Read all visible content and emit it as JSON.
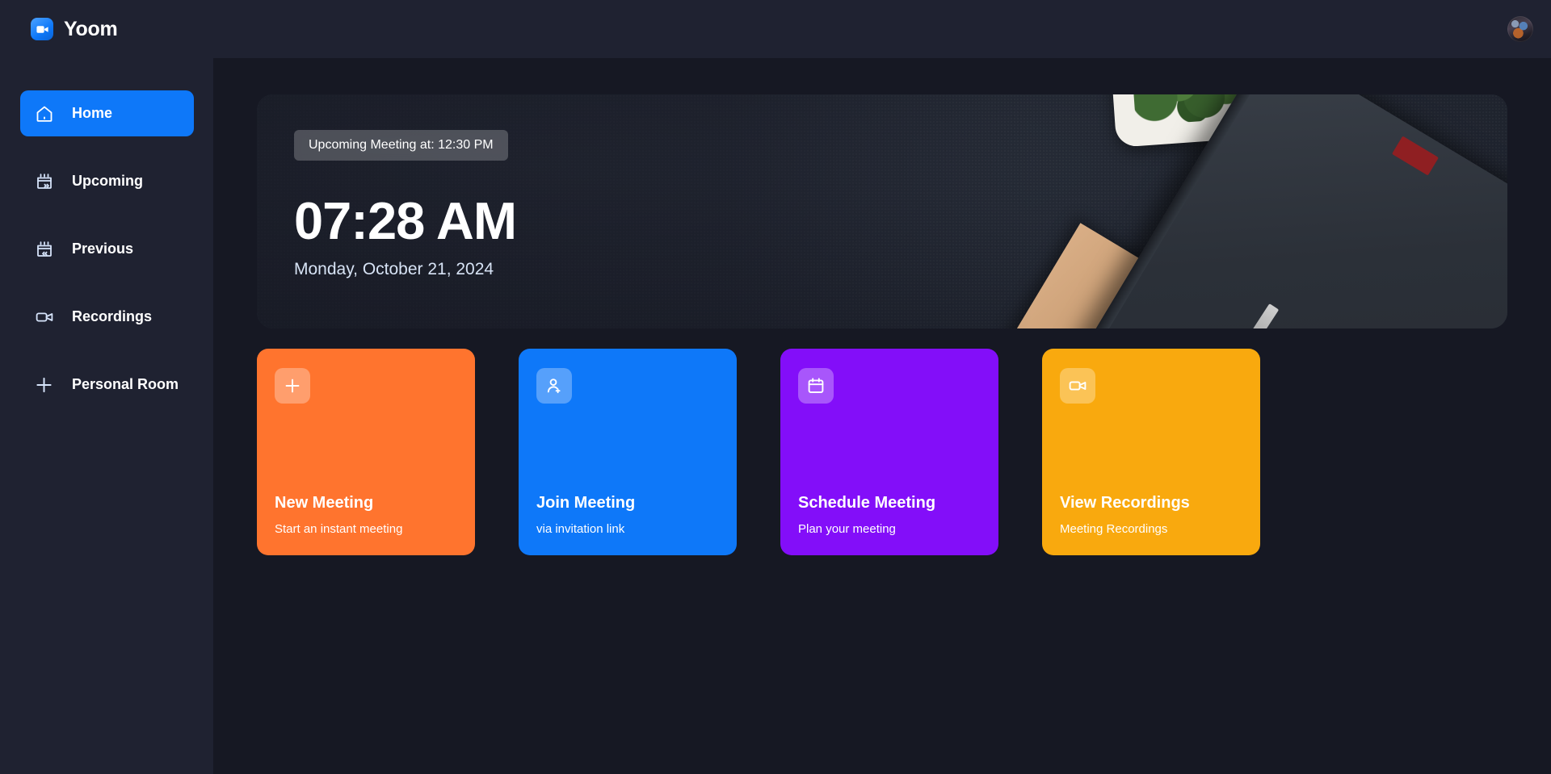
{
  "header": {
    "brand_name": "Yoom",
    "brand_icon": "video-camera-icon",
    "avatar_icon": "user-avatar"
  },
  "sidebar": {
    "items": [
      {
        "label": "Home",
        "icon": "home-icon",
        "active": true
      },
      {
        "label": "Upcoming",
        "icon": "calendar-forward-icon",
        "active": false
      },
      {
        "label": "Previous",
        "icon": "calendar-back-icon",
        "active": false
      },
      {
        "label": "Recordings",
        "icon": "video-camera-icon",
        "active": false
      },
      {
        "label": "Personal Room",
        "icon": "plus-icon",
        "active": false
      }
    ],
    "active_color": "#0e78f9"
  },
  "hero": {
    "upcoming_label": "Upcoming Meeting at: 12:30 PM",
    "time": "07:28 AM",
    "date": "Monday, October 21, 2024"
  },
  "cards": [
    {
      "title": "New Meeting",
      "subtitle": "Start an instant meeting",
      "icon": "plus-icon",
      "color": "#ff742e"
    },
    {
      "title": "Join Meeting",
      "subtitle": "via invitation link",
      "icon": "user-plus-icon",
      "color": "#0e78f9"
    },
    {
      "title": "Schedule Meeting",
      "subtitle": "Plan your meeting",
      "icon": "calendar-icon",
      "color": "#830ef9"
    },
    {
      "title": "View Recordings",
      "subtitle": "Meeting Recordings",
      "icon": "video-camera-icon",
      "color": "#f9a90e"
    }
  ]
}
